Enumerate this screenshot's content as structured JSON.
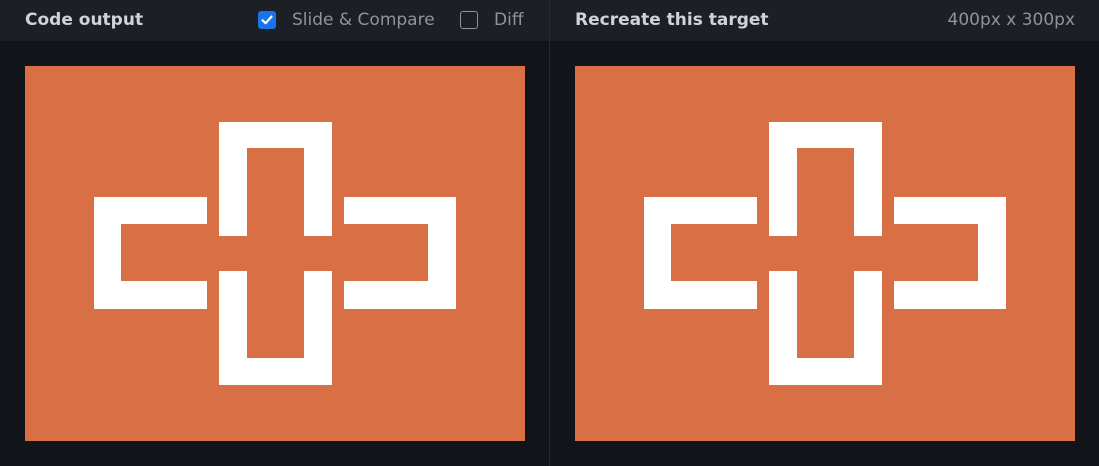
{
  "left_panel": {
    "title": "Code output",
    "options": [
      {
        "label": "Slide & Compare",
        "checked": true,
        "icon": "checkmark-icon"
      },
      {
        "label": "Diff",
        "checked": false
      }
    ]
  },
  "right_panel": {
    "title": "Recreate this target",
    "size_label": "400px x 300px"
  },
  "colors": {
    "background": "#111418",
    "header": "#1c2026",
    "canvas_bg": "#d97045",
    "shape": "#ffffff",
    "accent": "#1a73e8"
  }
}
